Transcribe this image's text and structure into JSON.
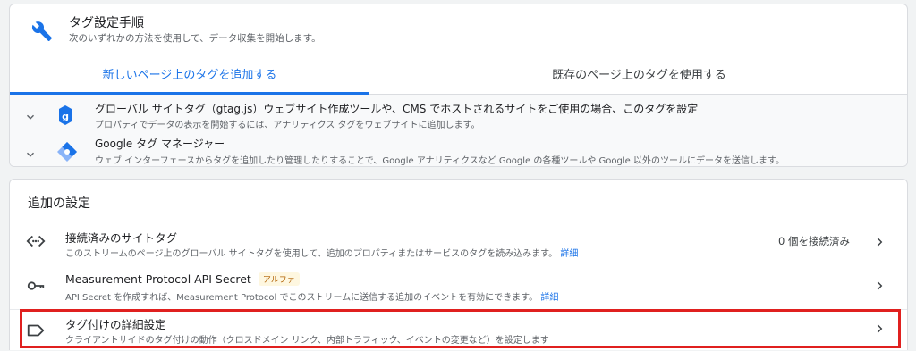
{
  "header": {
    "title": "タグ設定手順",
    "subtitle": "次のいずれかの方法を使用して、データ収集を開始します。",
    "icon": "wrench-icon"
  },
  "tabs": [
    {
      "label": "新しいページ上のタグを追加する",
      "active": true
    },
    {
      "label": "既存のページ上のタグを使用する",
      "active": false
    }
  ],
  "options": [
    {
      "title": "グローバル サイトタグ（gtag.js）ウェブサイト作成ツールや、CMS でホストされるサイトをご使用の場合、このタグを設定",
      "subtitle": "プロパティでデータの表示を開始するには、アナリティクス タグをウェブサイトに追加します。",
      "icon": "gtag-icon"
    },
    {
      "title": "Google タグ マネージャー",
      "subtitle": "ウェブ インターフェースからタグを追加したり管理したりすることで、Google アナリティクスなど Google の各種ツールや Google 以外のツールにデータを送信します。",
      "icon": "tag-manager-icon"
    }
  ],
  "additional": {
    "title": "追加の設定",
    "rows": [
      {
        "title": "接続済みのサイトタグ",
        "subtitle": "このストリームのページ上のグローバル サイトタグを使用して、追加のプロパティまたはサービスのタグを読み込みます。",
        "link": "詳細",
        "status": "0 個を接続済み",
        "icon": "code-icon"
      },
      {
        "title": "Measurement Protocol API Secret",
        "badge": "アルファ",
        "subtitle": "API Secret を作成すれば、Measurement Protocol でこのストリームに送信する追加のイベントを有効にできます。",
        "link": "詳細",
        "icon": "key-icon"
      },
      {
        "title": "タグ付けの詳細設定",
        "subtitle": "クライアントサイドのタグ付けの動作（クロスドメイン リンク、内部トラフィック、イベントの変更など）を設定します",
        "icon": "label-icon"
      }
    ]
  },
  "colors": {
    "accent": "#1a73e8",
    "highlight": "#e0201f",
    "badge_bg": "#fef7e0",
    "badge_text": "#b06000"
  }
}
